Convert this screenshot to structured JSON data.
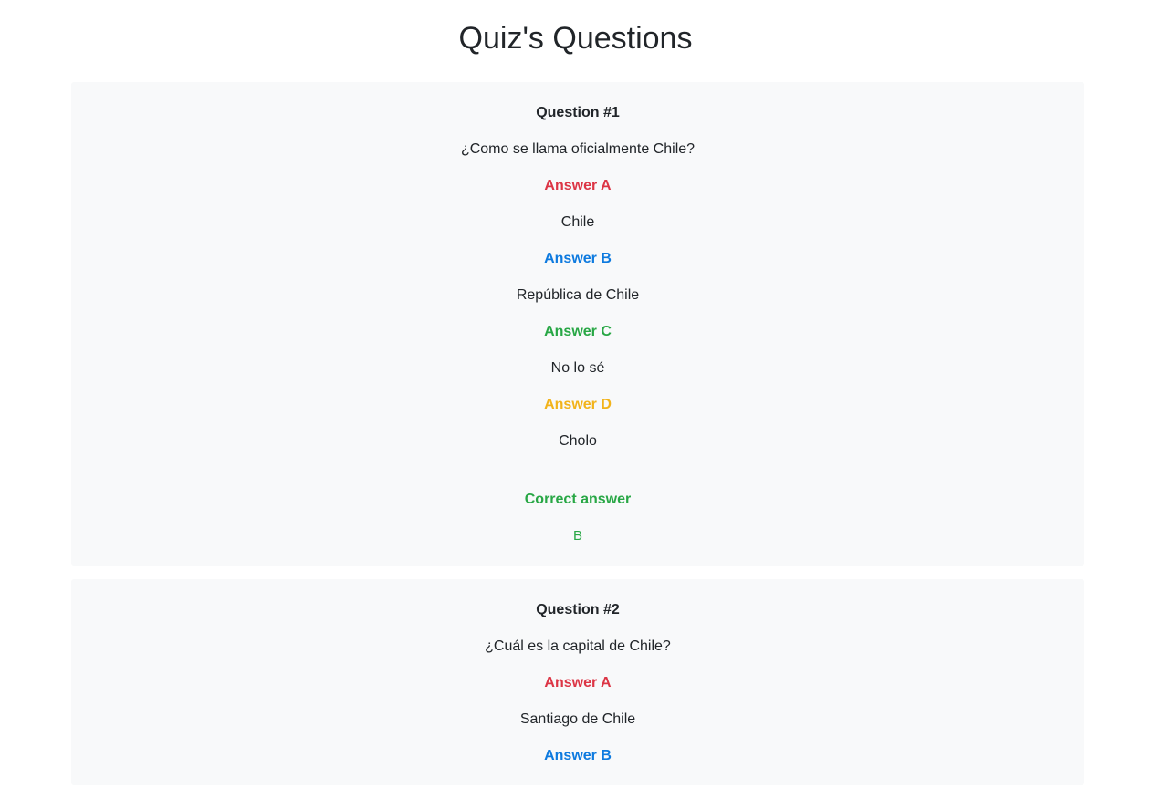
{
  "page": {
    "title": "Quiz's Questions"
  },
  "labels": {
    "answer_a": "Answer A",
    "answer_b": "Answer B",
    "answer_c": "Answer C",
    "answer_d": "Answer D",
    "correct_answer": "Correct answer"
  },
  "colors": {
    "answer_a": "#dc3545",
    "answer_b": "#0d7adf",
    "answer_c": "#28a745",
    "answer_d": "#f2b31a",
    "card_background": "#f8f9fa"
  },
  "questions": [
    {
      "heading": "Question #1",
      "text": "¿Como se llama oficialmente Chile?",
      "answer_a": "Chile",
      "answer_b": "República de Chile",
      "answer_c": "No lo sé",
      "answer_d": "Cholo",
      "correct": "B"
    },
    {
      "heading": "Question #2",
      "text": "¿Cuál es la capital de Chile?",
      "answer_a": "Santiago de Chile"
    }
  ]
}
